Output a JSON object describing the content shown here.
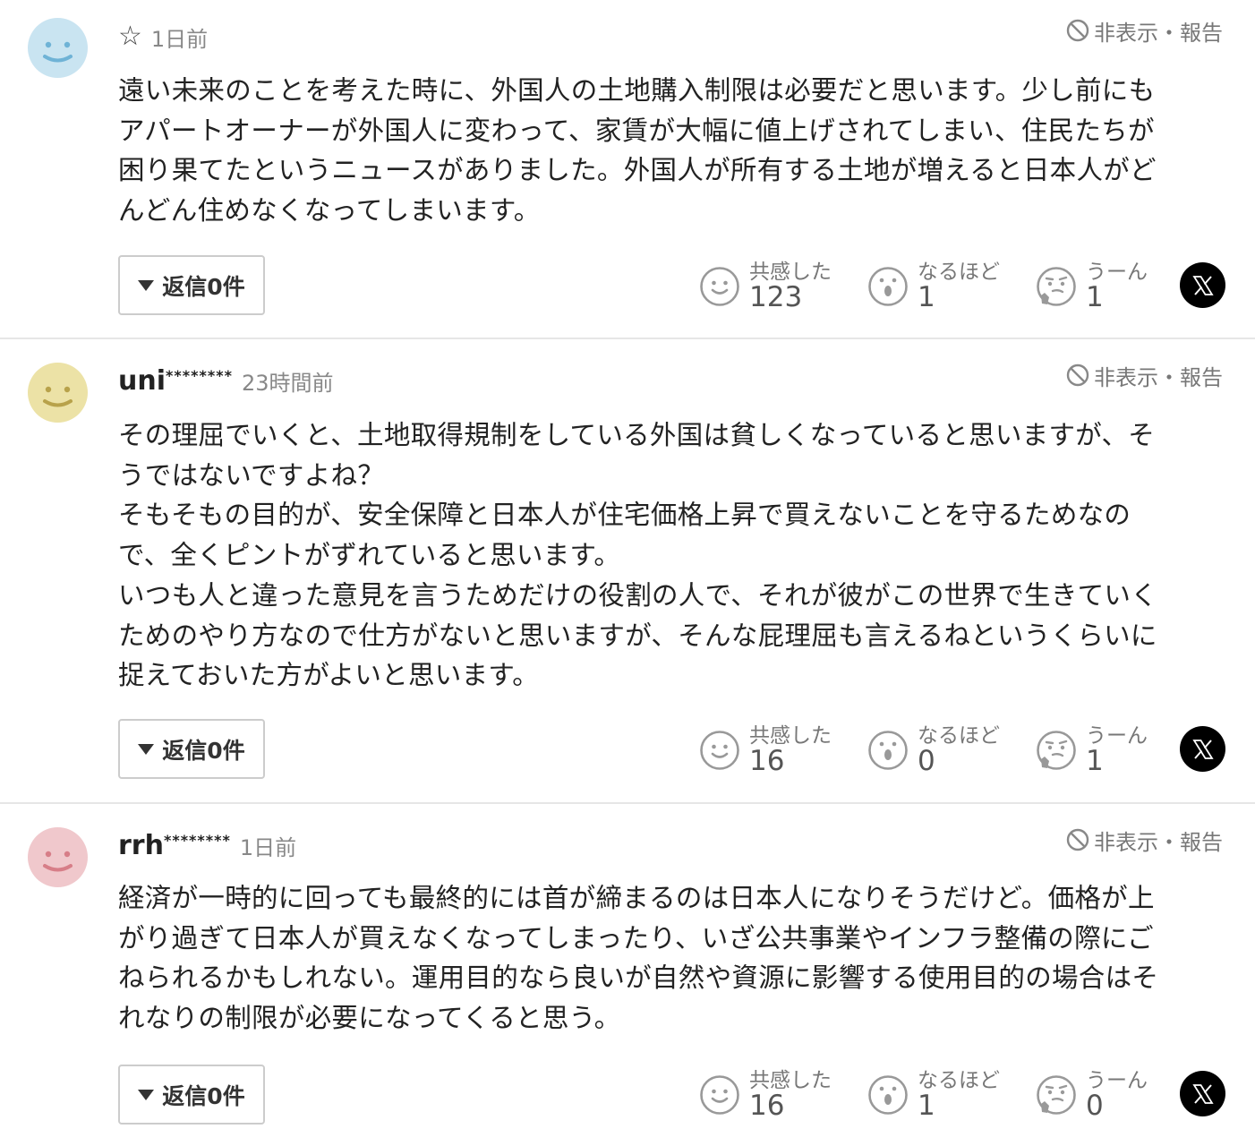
{
  "common": {
    "hide_report": "非表示・報告",
    "reply_label": "返信0件",
    "reaction_labels": {
      "empathy": "共感した",
      "insight": "なるほど",
      "hmm": "うーん"
    }
  },
  "comments": [
    {
      "avatar_color": "#c9e4f1",
      "avatar_face_color": "#6fb3d6",
      "username": "",
      "star_icon": "☆",
      "timestamp": "1日前",
      "lines": [
        "遠い未来のことを考えた時に、外国人の土地購入制限は必要だと思います。少し前にも",
        "アパートオーナーが外国人に変わって、家賃が大幅に値上げされてしまい、住民たちが",
        "困り果てたというニュースがありました。外国人が所有する土地が増えると日本人がど",
        "んどん住めなくなってしまいます。"
      ],
      "counts": {
        "empathy": "123",
        "insight": "1",
        "hmm": "1"
      }
    },
    {
      "avatar_color": "#ece2a6",
      "avatar_face_color": "#b8a24a",
      "username": "uni",
      "masked": "********",
      "timestamp": "23時間前",
      "lines": [
        "その理屈でいくと、土地取得規制をしている外国は貧しくなっていると思いますが、そ",
        "うではないですよね？",
        "そもそもの目的が、安全保障と日本人が住宅価格上昇で買えないことを守るためなの",
        "で、全くピントがずれていると思います。",
        "いつも人と違った意見を言うためだけの役割の人で、それが彼がこの世界で生きていく",
        "ためのやり方なので仕方がないと思いますが、そんな屁理屈も言えるねというくらいに",
        "捉えておいた方がよいと思います。"
      ],
      "counts": {
        "empathy": "16",
        "insight": "0",
        "hmm": "1"
      }
    },
    {
      "avatar_color": "#f0c8cc",
      "avatar_face_color": "#d77e88",
      "username": "rrh",
      "masked": "********",
      "timestamp": "1日前",
      "lines": [
        "経済が一時的に回っても最終的には首が締まるのは日本人になりそうだけど。価格が上",
        "がり過ぎて日本人が買えなくなってしまったり、いざ公共事業やインフラ整備の際にご",
        "ねられるかもしれない。運用目的なら良いが自然や資源に影響する使用目的の場合はそ",
        "れなりの制限が必要になってくると思う。"
      ],
      "counts": {
        "empathy": "16",
        "insight": "1",
        "hmm": "0"
      }
    }
  ]
}
